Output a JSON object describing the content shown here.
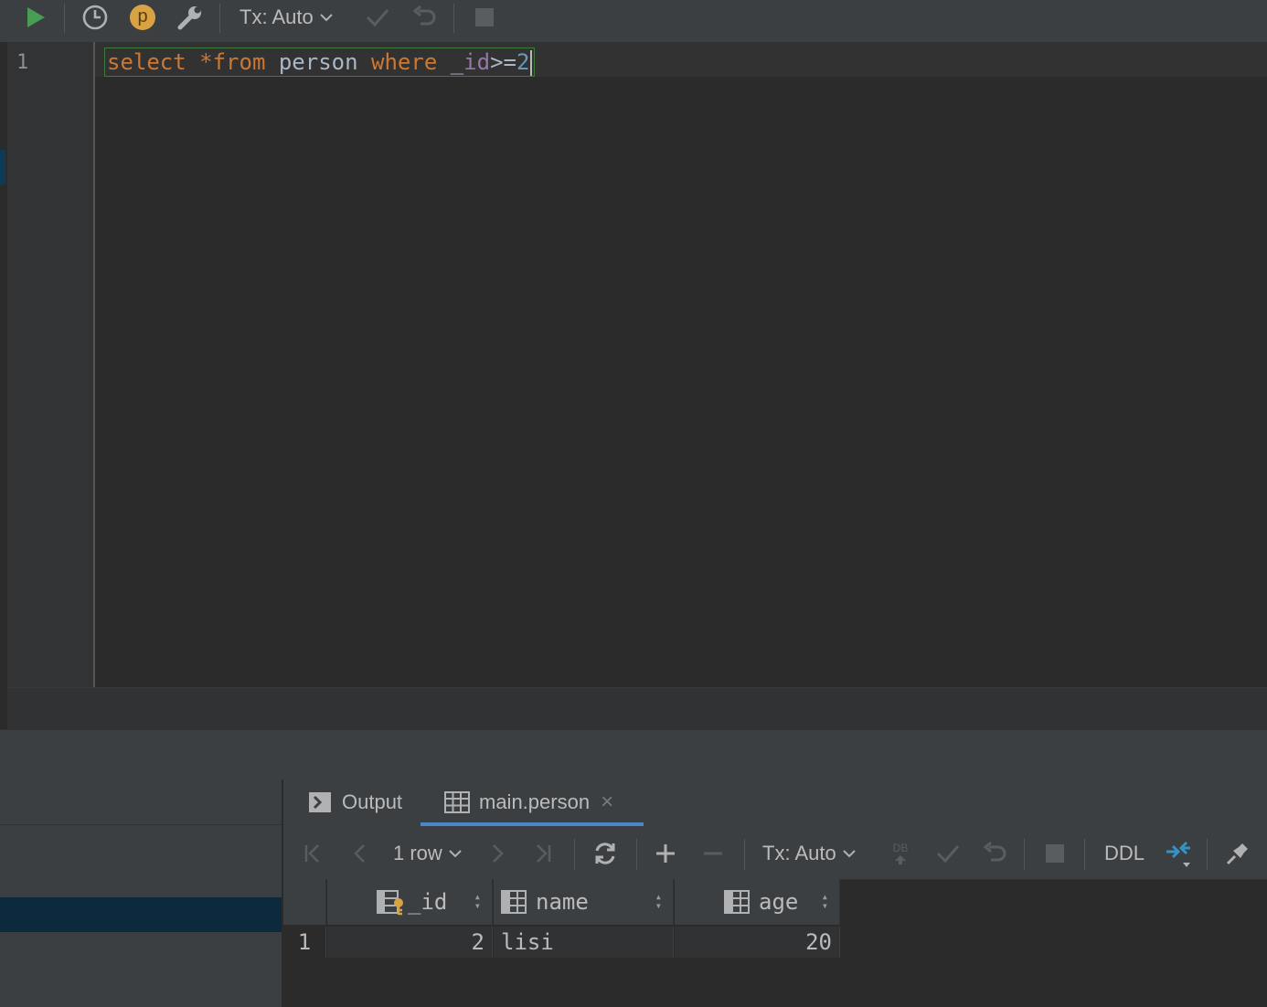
{
  "toolbar": {
    "tx_label": "Tx: Auto",
    "profile_badge": "p",
    "icons": [
      "run-icon",
      "history-icon",
      "profile-icon",
      "settings-wrench-icon",
      "chevron-down-icon",
      "commit-check-icon",
      "rollback-icon",
      "stop-icon"
    ]
  },
  "editor": {
    "line_number": "1",
    "code": {
      "kw_select": "select",
      "sp1": " ",
      "star": "*",
      "kw_from": "from",
      "sp2": " ",
      "table": "person",
      "sp3": " ",
      "kw_where": "where",
      "sp4": " ",
      "underscore": "_",
      "column": "id",
      "operator": ">=",
      "value": "2"
    }
  },
  "results": {
    "tabs": [
      {
        "label": "Output",
        "icon": "output-console-icon"
      },
      {
        "label": "main.person",
        "icon": "table-grid-icon",
        "close": "×"
      }
    ],
    "toolbar": {
      "row_count": "1 row",
      "tx_label": "Tx: Auto",
      "db_label": "DB",
      "ddl_label": "DDL"
    },
    "columns": [
      {
        "label": "_id",
        "icon": "primary-key-column-icon"
      },
      {
        "label": "name",
        "icon": "column-icon"
      },
      {
        "label": "age",
        "icon": "column-icon"
      }
    ],
    "rows": [
      {
        "index": "1",
        "cells": [
          "2",
          "lisi",
          "20"
        ]
      }
    ]
  },
  "colors": {
    "background": "#2b2b2b",
    "panel": "#3c3f41",
    "keyword": "#cc7832",
    "identifier": "#a9b7c6",
    "column_ref": "#9876aa",
    "number": "#6897bb",
    "run_green": "#499c54",
    "selection_blue": "#0d293e",
    "accent_blue": "#4a88c7"
  }
}
